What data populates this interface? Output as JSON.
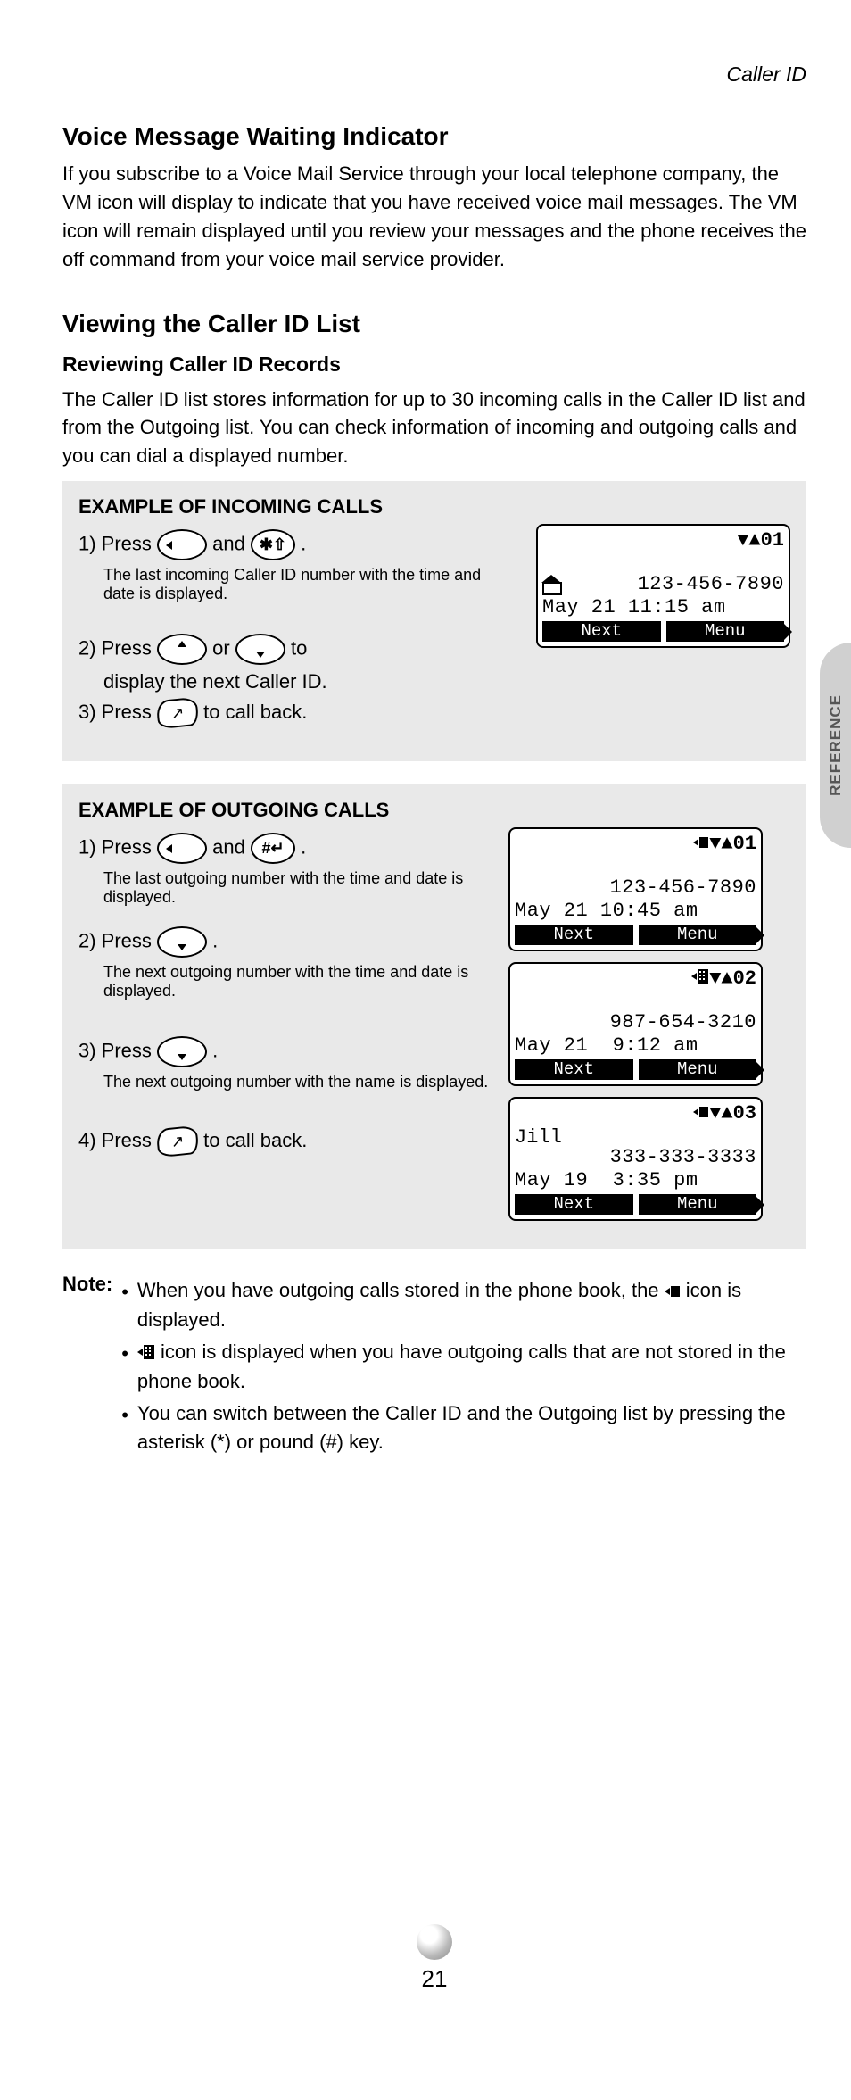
{
  "header": {
    "topicLabel": "Caller ID"
  },
  "sideTab": {
    "label": "REFERENCE"
  },
  "section1": {
    "heading": "Voice Message Waiting Indicator",
    "body": "If you subscribe to a Voice Mail Service through your local telephone company, the VM icon will display to indicate that you have received voice mail messages. The VM icon will remain displayed until you review your messages and the phone receives the off command from your voice mail service provider."
  },
  "section2": {
    "heading": "Viewing the Caller ID List",
    "sub1": {
      "title": "Reviewing Caller ID Records",
      "body": "The Caller ID list stores information for up to 30 incoming calls in the Caller ID list and from the Outgoing list. You can check information of incoming and outgoing calls and you can dial a displayed number."
    }
  },
  "example1": {
    "title": "EXAMPLE OF INCOMING CALLS",
    "step1_a": "1) Press ",
    "step1_b": " and ",
    "step1_c": ".",
    "note1": "The last incoming Caller ID number with the time and date is displayed.",
    "step2_a": "2) Press ",
    "step2_b": " or ",
    "step2_c": " to",
    "step2_line2": "display the next Caller ID.",
    "step3_a": "3) Press ",
    "step3_b": " to call back."
  },
  "lcd1": {
    "indexRow": "▼▲01",
    "number": "123-456-7890",
    "datetime": "May 21 11:15 am",
    "sk_left": "Next",
    "sk_right": "Menu"
  },
  "example2": {
    "title": "EXAMPLE OF OUTGOING CALLS",
    "step1_a": "1) Press ",
    "step1_b": " and ",
    "step1_c": ".",
    "note1": "The last outgoing number with the time and date is displayed.",
    "step2_a": "2) Press ",
    "step2_b": ".",
    "note2": "The next outgoing number with the time and date is displayed.",
    "step3_a": "3) Press ",
    "step3_b": ".",
    "note3": "The next outgoing number with the name is displayed.",
    "step4_a": "4) Press ",
    "step4_b": " to call back."
  },
  "lcd2": {
    "indexRow": "▼▲01",
    "number": "123-456-7890",
    "datetime": "May 21 10:45 am",
    "sk_left": "Next",
    "sk_right": "Menu"
  },
  "lcd3": {
    "indexRow": "▼▲02",
    "number": "987-654-3210",
    "datetime": "May 21  9:12 am",
    "sk_left": "Next",
    "sk_right": "Menu"
  },
  "lcd4": {
    "indexRow": "▼▲03",
    "name": "Jill",
    "number": "333-333-3333",
    "datetime": "May 19  3:35 pm",
    "sk_left": "Next",
    "sk_right": "Menu"
  },
  "notes": {
    "label": "Note:",
    "n1_a": "When you have outgoing calls stored in the phone book, the ",
    "n1_b": " icon is displayed.",
    "n2_a": "",
    "n2_b": " icon is displayed when you have outgoing calls that are not stored in the phone book.",
    "n3": "You can switch between the Caller ID and the Outgoing list by pressing the asterisk (*) or pound (#) key."
  },
  "footer": {
    "pageNumber": "21"
  }
}
